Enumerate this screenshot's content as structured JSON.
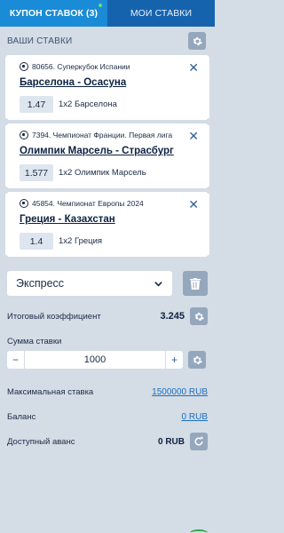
{
  "tabs": [
    {
      "label": "КУПОН СТАВОК (3)",
      "active": true
    },
    {
      "label": "МОИ СТАВКИ",
      "active": false
    }
  ],
  "section": {
    "title": "ВАШИ СТАВКИ",
    "settings_icon": "gear-icon"
  },
  "bets": [
    {
      "league": "80656. Суперкубок Испании",
      "match": "Барселона - Осасуна",
      "odd": "1.47",
      "pick": "1х2 Барселона"
    },
    {
      "league": "7394. Чемпионат Франции. Первая лига",
      "match": "Олимпик Марсель - Страсбург",
      "odd": "1.577",
      "pick": "1х2 Олимпик Марсель"
    },
    {
      "league": "45854. Чемпионат Европы 2024",
      "match": "Греция - Казахстан",
      "odd": "1.4",
      "pick": "1х2 Греция"
    }
  ],
  "express": {
    "selected": "Экспресс"
  },
  "total_coef": {
    "label": "Итоговый коэффициент",
    "value": "3.245"
  },
  "stake": {
    "label": "Сумма ставки",
    "minus": "−",
    "plus": "+",
    "amount": "1000"
  },
  "info": {
    "max_stake": {
      "label": "Максимальная ставка",
      "value": "1500000 RUB"
    },
    "balance": {
      "label": "Баланс",
      "value": "0 RUB"
    },
    "advance": {
      "label": "Доступный аванс",
      "value": "0 RUB"
    }
  },
  "colors": {
    "tab_active": "#1a8bd6",
    "tab_inactive": "#1663ad",
    "background": "#d4dce6",
    "link": "#1b6fbf",
    "accent_dot": "#69e06b"
  }
}
